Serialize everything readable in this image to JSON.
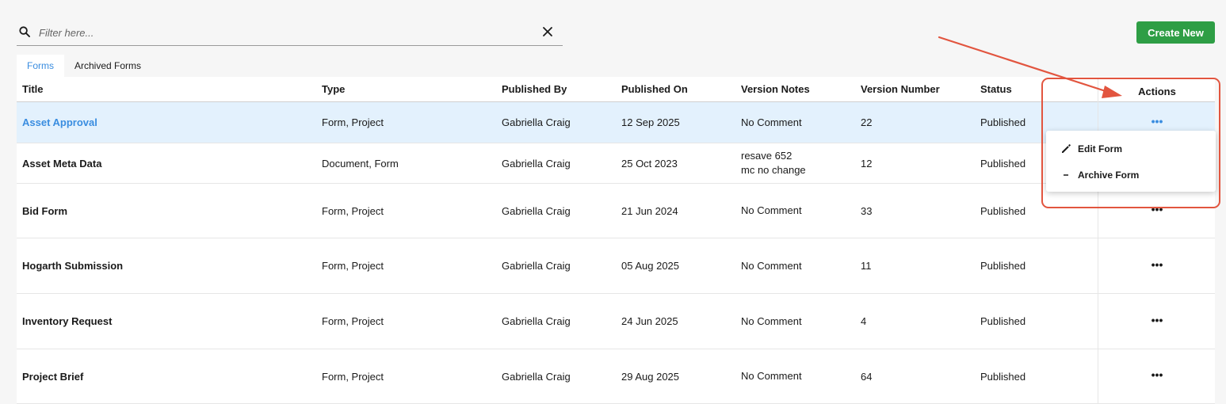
{
  "search": {
    "placeholder": "Filter here...",
    "value": ""
  },
  "toolbar": {
    "create_label": "Create New"
  },
  "tabs": [
    {
      "label": "Forms",
      "active": true
    },
    {
      "label": "Archived Forms",
      "active": false
    }
  ],
  "table": {
    "columns": {
      "title": "Title",
      "type": "Type",
      "published_by": "Published By",
      "published_on": "Published On",
      "version_notes": "Version Notes",
      "version_number": "Version Number",
      "status": "Status",
      "actions": "Actions"
    },
    "rows": [
      {
        "title": "Asset Approval",
        "type": "Form, Project",
        "published_by": "Gabriella Craig",
        "published_on": "12 Sep 2025",
        "notes": [
          "No Comment"
        ],
        "version": "22",
        "status": "Published",
        "actions": "•••"
      },
      {
        "title": "Asset Meta Data",
        "type": "Document, Form",
        "published_by": "Gabriella Craig",
        "published_on": "25 Oct 2023",
        "notes": [
          "resave 652",
          "mc no change"
        ],
        "version": "12",
        "status": "Published",
        "actions": "•••"
      },
      {
        "title": "Bid Form",
        "type": "Form, Project",
        "published_by": "Gabriella Craig",
        "published_on": "21 Jun 2024",
        "notes": [
          "No Comment"
        ],
        "version": "33",
        "status": "Published",
        "actions": "•••"
      },
      {
        "title": "Hogarth Submission",
        "type": "Form, Project",
        "published_by": "Gabriella Craig",
        "published_on": "05 Aug 2025",
        "notes": [
          "No Comment"
        ],
        "version": "11",
        "status": "Published",
        "actions": "•••"
      },
      {
        "title": "Inventory Request",
        "type": "Form, Project",
        "published_by": "Gabriella Craig",
        "published_on": "24 Jun 2025",
        "notes": [
          "No Comment"
        ],
        "version": "4",
        "status": "Published",
        "actions": "•••"
      },
      {
        "title": "Project Brief",
        "type": "Form, Project",
        "published_by": "Gabriella Craig",
        "published_on": "29 Aug 2025",
        "notes": [
          "No Comment"
        ],
        "version": "64",
        "status": "Published",
        "actions": "•••"
      }
    ]
  },
  "menu": {
    "items": [
      {
        "label": "Edit Form",
        "icon": "pencil-icon"
      },
      {
        "label": "Archive Form",
        "icon": "minus-icon"
      }
    ]
  },
  "icons": {
    "search": "search-icon",
    "clear": "close-icon",
    "actions": "more-horizontal-icon"
  },
  "colors": {
    "accent": "#3a8de0",
    "create_button": "#2e9e45",
    "selected_row": "#e3f1fd",
    "annotation": "#e2553f"
  }
}
